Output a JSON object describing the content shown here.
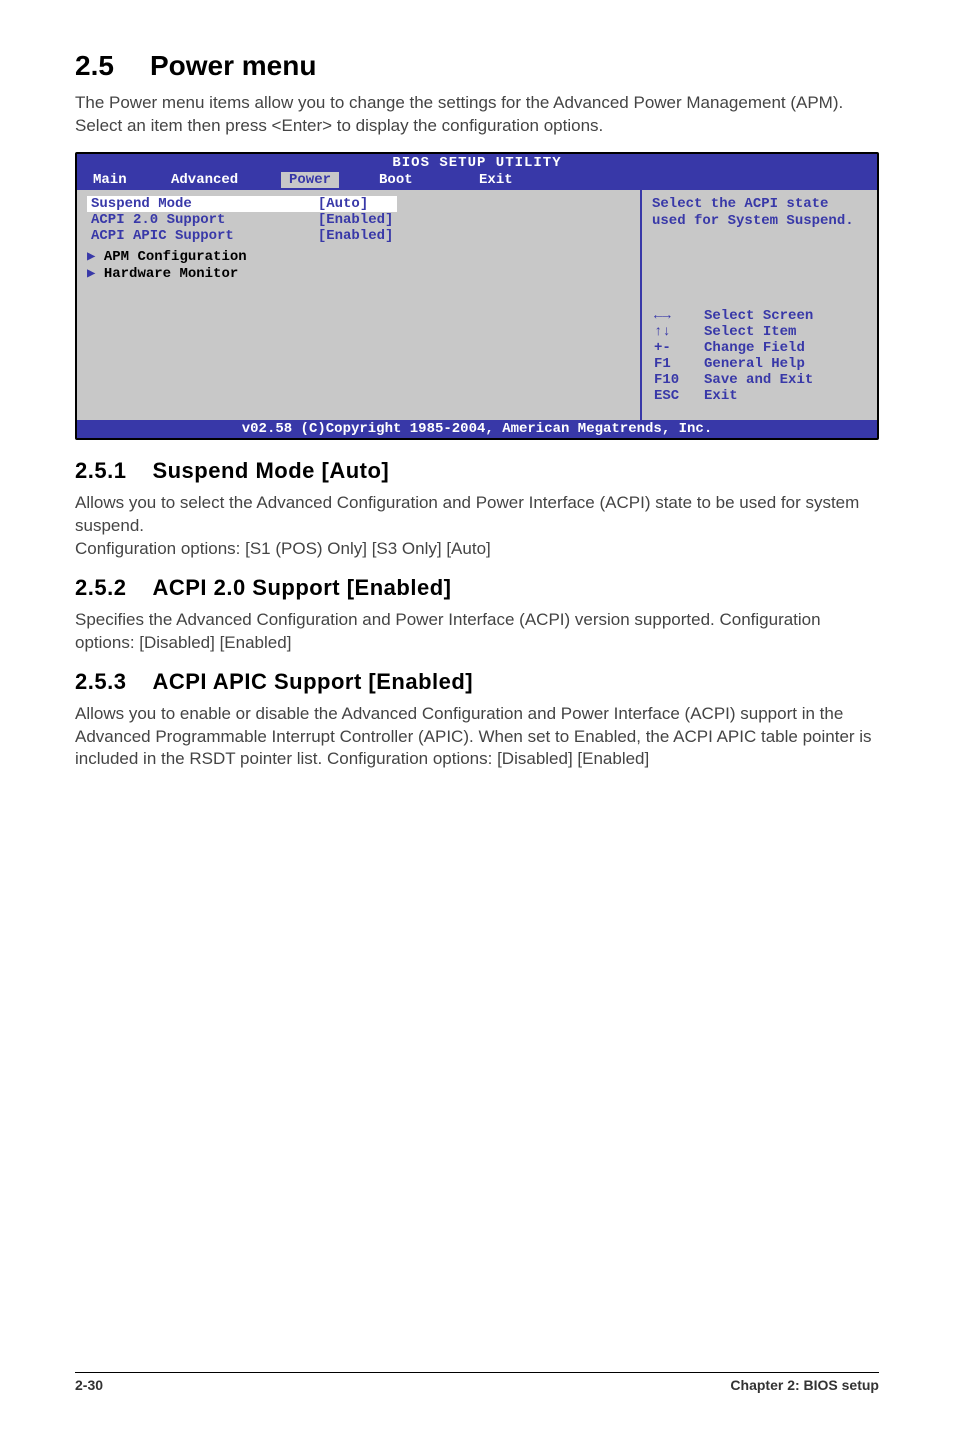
{
  "heading": {
    "number": "2.5",
    "title": "Power menu"
  },
  "intro": "The Power menu items allow you to change the settings for the Advanced Power Management (APM). Select an item then press <Enter> to display the configuration options.",
  "bios": {
    "title": "BIOS SETUP UTILITY",
    "tabs": [
      "Main",
      "Advanced",
      "Power",
      "Boot",
      "Exit"
    ],
    "active_tab": "Power",
    "items": [
      {
        "label": "Suspend Mode",
        "value": "[Auto]"
      },
      {
        "label": "ACPI 2.0 Support",
        "value": "[Enabled]"
      },
      {
        "label": "ACPI APIC Support",
        "value": "[Enabled]"
      }
    ],
    "subitems": [
      "APM Configuration",
      "Hardware Monitor"
    ],
    "help_text": "Select the ACPI state used for System Suspend.",
    "keys": [
      {
        "k": "←→",
        "d": "Select Screen"
      },
      {
        "k": "↑↓",
        "d": "Select Item"
      },
      {
        "k": "+-",
        "d": "Change Field"
      },
      {
        "k": "F1",
        "d": "General Help"
      },
      {
        "k": "F10",
        "d": "Save and Exit"
      },
      {
        "k": "ESC",
        "d": "Exit"
      }
    ],
    "footer": "v02.58 (C)Copyright 1985-2004, American Megatrends, Inc."
  },
  "sections": {
    "s1": {
      "num": "2.5.1",
      "title": "Suspend Mode [Auto]",
      "p1": "Allows you to select the Advanced Configuration and Power Interface (ACPI) state to be used for system suspend.",
      "p2": "Configuration options: [S1 (POS) Only] [S3 Only] [Auto]"
    },
    "s2": {
      "num": "2.5.2",
      "title": "ACPI 2.0 Support [Enabled]",
      "p1": "Specifies the Advanced Configuration and Power Interface (ACPI) version supported. Configuration options: [Disabled] [Enabled]"
    },
    "s3": {
      "num": "2.5.3",
      "title": "ACPI APIC Support [Enabled]",
      "p1": "Allows you to enable or disable the Advanced Configuration and Power Interface (ACPI) support in the Advanced Programmable Interrupt Controller (APIC). When set to Enabled, the ACPI APIC table pointer is included in the RSDT pointer list. Configuration options: [Disabled] [Enabled]"
    }
  },
  "footer": {
    "left": "2-30",
    "right": "Chapter 2: BIOS setup"
  }
}
